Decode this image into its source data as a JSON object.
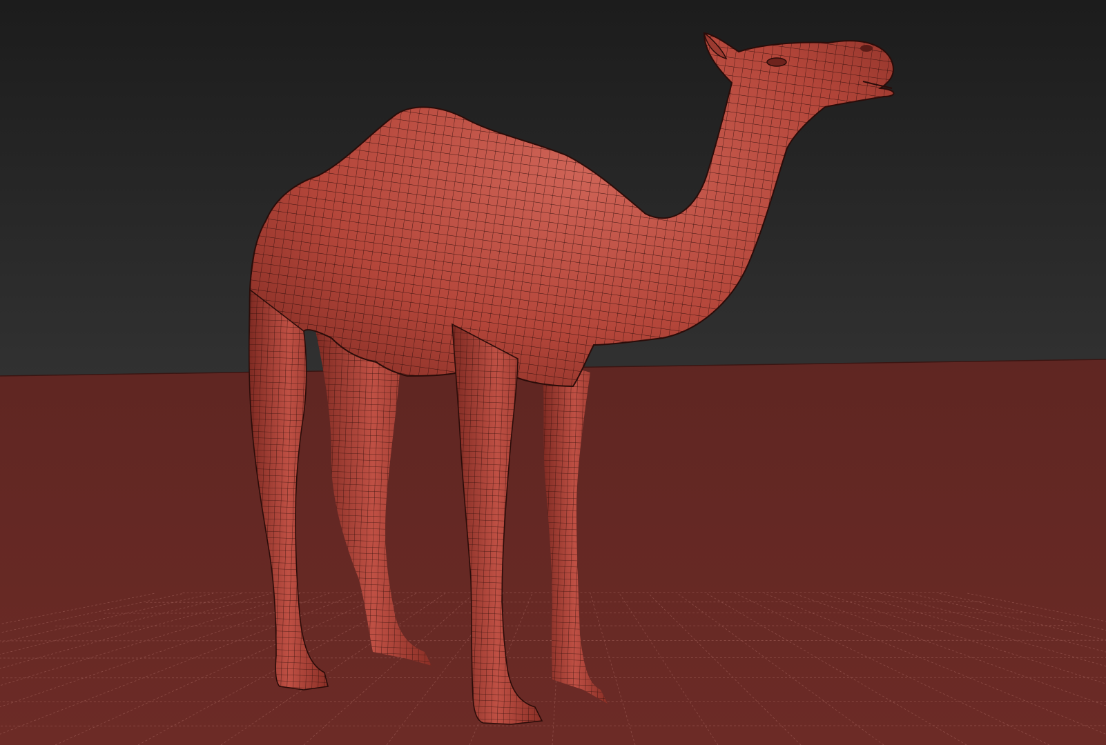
{
  "scene": {
    "subject": "camel-wireframe-model",
    "colors": {
      "background_top": "#1c1c1c",
      "background_bottom": "#2e2e2e",
      "ground": "#692a26",
      "ground_far": "#5f2622",
      "model_base": "#b8473b",
      "model_light": "#d0665a",
      "model_shadow": "#6e231d",
      "wire": "#2a0c09",
      "grid": "#b8776f"
    }
  }
}
